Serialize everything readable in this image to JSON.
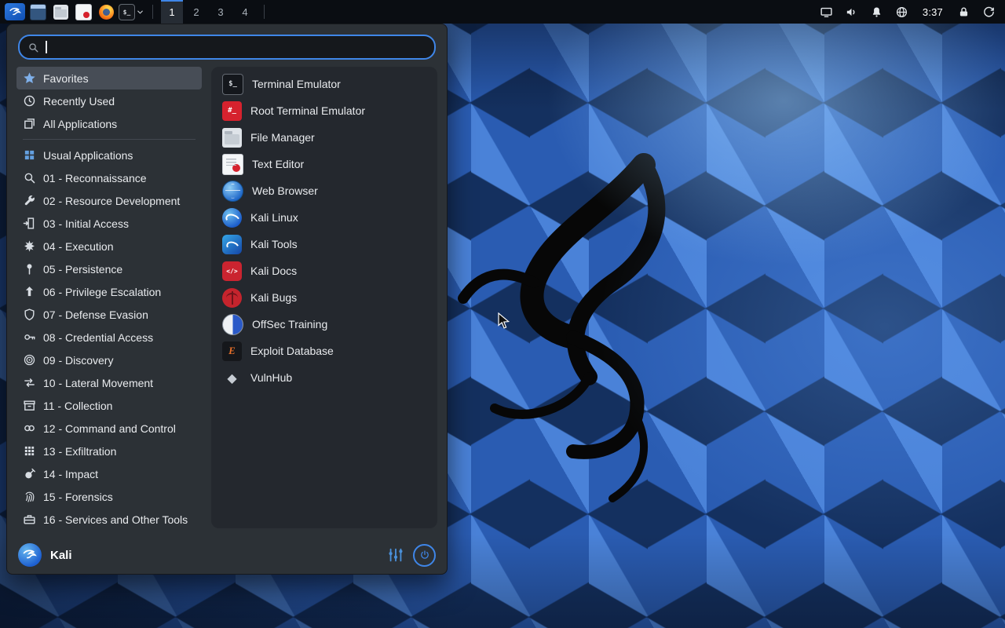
{
  "panel": {
    "launchers": [
      {
        "icon": "kali-menu-icon"
      },
      {
        "icon": "window-icon"
      },
      {
        "icon": "file-manager-icon"
      },
      {
        "icon": "text-editor-icon"
      },
      {
        "icon": "firefox-icon"
      },
      {
        "icon": "terminal-icon"
      }
    ],
    "workspaces": [
      "1",
      "2",
      "3",
      "4"
    ],
    "active_workspace": "1",
    "status_icons": [
      "display-icon",
      "volume-icon",
      "notifications-icon",
      "network-icon"
    ],
    "clock": "3:37",
    "session_icons": [
      "lock-icon",
      "logout-icon"
    ]
  },
  "menu": {
    "search": {
      "value": "",
      "placeholder": ""
    },
    "categories": [
      {
        "label": "Favorites",
        "icon": "star-icon",
        "icon_ref": "#i-star",
        "selected": true
      },
      {
        "label": "Recently Used",
        "icon": "clock-icon",
        "icon_ref": "#i-clock"
      },
      {
        "label": "All Applications",
        "icon": "all-applications-icon",
        "icon_ref": "#i-apps"
      },
      {
        "label": "Usual Applications",
        "icon": "grid-icon",
        "icon_ref": "#i-grid"
      },
      {
        "label": "01 - Reconnaissance",
        "icon": "magnifier-icon",
        "icon_ref": "#i-search"
      },
      {
        "label": "02 - Resource Development",
        "icon": "wrench-icon",
        "icon_ref": "#i-wrench"
      },
      {
        "label": "03 - Initial Access",
        "icon": "door-arrow-icon",
        "icon_ref": "#i-door"
      },
      {
        "label": "04 - Execution",
        "icon": "burst-icon",
        "icon_ref": "#i-burst"
      },
      {
        "label": "05 - Persistence",
        "icon": "pin-icon",
        "icon_ref": "#i-pin"
      },
      {
        "label": "06 - Privilege Escalation",
        "icon": "up-arrow-icon",
        "icon_ref": "#i-up"
      },
      {
        "label": "07 - Defense Evasion",
        "icon": "shield-icon",
        "icon_ref": "#i-shield"
      },
      {
        "label": "08 - Credential Access",
        "icon": "key-icon",
        "icon_ref": "#i-key"
      },
      {
        "label": "09 - Discovery",
        "icon": "radar-icon",
        "icon_ref": "#i-radar"
      },
      {
        "label": "10 - Lateral Movement",
        "icon": "swap-arrows-icon",
        "icon_ref": "#i-swap"
      },
      {
        "label": "11 - Collection",
        "icon": "archive-icon",
        "icon_ref": "#i-box"
      },
      {
        "label": "12 - Command and Control",
        "icon": "link-icon",
        "icon_ref": "#i-link"
      },
      {
        "label": "13 - Exfiltration",
        "icon": "grid9-icon",
        "icon_ref": "#i-exfil"
      },
      {
        "label": "14 - Impact",
        "icon": "impact-icon",
        "icon_ref": "#i-impact"
      },
      {
        "label": "15 - Forensics",
        "icon": "fingerprint-icon",
        "icon_ref": "#i-finger"
      },
      {
        "label": "16 - Services and Other Tools",
        "icon": "toolbox-icon",
        "icon_ref": "#i-toolbox"
      }
    ],
    "apps": [
      {
        "label": "Terminal Emulator",
        "icon": "terminal-emulator-icon"
      },
      {
        "label": "Root Terminal Emulator",
        "icon": "root-terminal-icon"
      },
      {
        "label": "File Manager",
        "icon": "file-manager-icon"
      },
      {
        "label": "Text Editor",
        "icon": "text-editor-icon"
      },
      {
        "label": "Web Browser",
        "icon": "web-browser-icon"
      },
      {
        "label": "Kali Linux",
        "icon": "kali-linux-icon"
      },
      {
        "label": "Kali Tools",
        "icon": "kali-tools-icon"
      },
      {
        "label": "Kali Docs",
        "icon": "kali-docs-icon"
      },
      {
        "label": "Kali Bugs",
        "icon": "kali-bugs-icon"
      },
      {
        "label": "OffSec Training",
        "icon": "offsec-training-icon"
      },
      {
        "label": "Exploit Database",
        "icon": "exploit-db-icon"
      },
      {
        "label": "VulnHub",
        "icon": "vulnhub-icon"
      }
    ],
    "footer": {
      "user_label": "Kali"
    }
  },
  "colors": {
    "accent": "#3f86e8",
    "panel_bg": "#0a0d12",
    "menu_bg": "#2c3136",
    "selection_bg": "#474d56",
    "wallpaper_base": "#2a5cb2"
  }
}
